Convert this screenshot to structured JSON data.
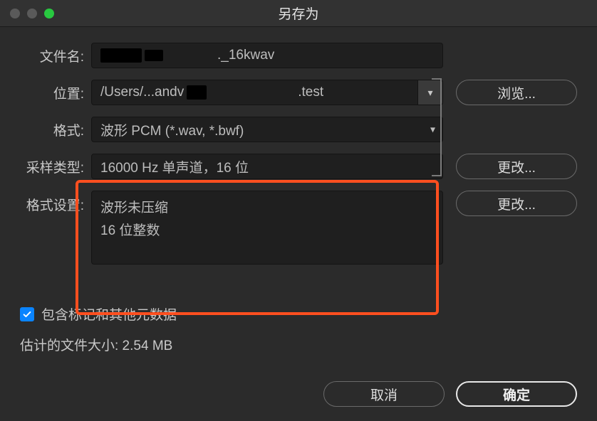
{
  "window": {
    "title": "另存为"
  },
  "labels": {
    "filename": "文件名:",
    "location": "位置:",
    "format": "格式:",
    "sample_type": "采样类型:",
    "format_settings": "格式设置:"
  },
  "fields": {
    "filename_value": "._16kwav",
    "location_value": "/Users/...andv                 .test",
    "format_value": "波形 PCM (*.wav, *.bwf)",
    "sample_type_value": "16000 Hz 单声道，16 位",
    "format_settings_line1": "波形未压缩",
    "format_settings_line2": "16 位整数"
  },
  "buttons": {
    "browse": "浏览...",
    "change1": "更改...",
    "change2": "更改...",
    "cancel": "取消",
    "ok": "确定"
  },
  "checkbox": {
    "label": "包含标记和其他元数据",
    "checked": true
  },
  "estimate_label": "估计的文件大小: 2.54 MB"
}
